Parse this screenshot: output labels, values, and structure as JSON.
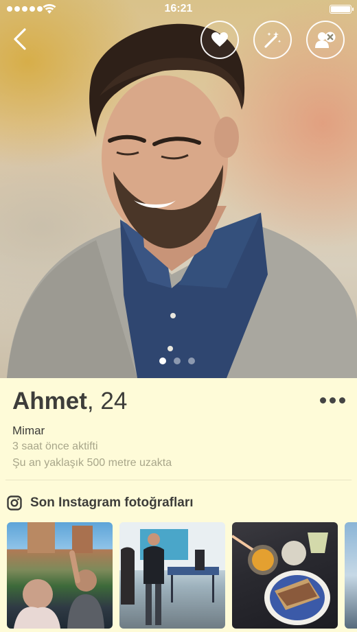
{
  "status_bar": {
    "time": "16:21"
  },
  "icons": {
    "back": "chevron-left-icon",
    "like": "heart-icon",
    "boost": "magic-wand-icon",
    "block": "user-block-icon",
    "more": "more-dots-icon",
    "instagram": "instagram-icon"
  },
  "photo_pager": {
    "count": 3,
    "active_index": 0
  },
  "profile": {
    "name": "Ahmet",
    "separator": ",",
    "age": "24",
    "job": "Mimar",
    "last_active": "3 saat önce aktifti",
    "distance": "Şu an yaklaşık 500 metre uzakta"
  },
  "instagram": {
    "title": "Son Instagram fotoğrafları"
  },
  "colors": {
    "background": "#fefbd8",
    "primary_text": "#3d3d3a",
    "secondary_text": "#a8a68a"
  }
}
